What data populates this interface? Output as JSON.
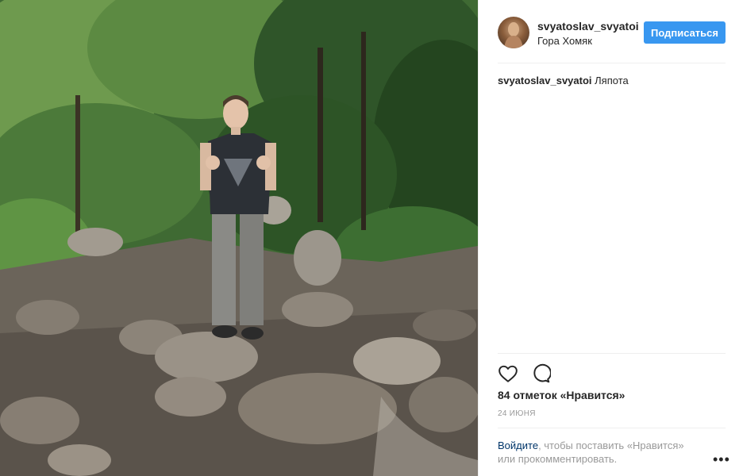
{
  "post": {
    "username": "svyatoslav_svyatoi",
    "location": "Гора Хомяк",
    "follow_label": "Подписаться",
    "caption_user": "svyatoslav_svyatoi",
    "caption_text": " Ляпота",
    "likes_text": "84 отметок «Нравится»",
    "date": "24 ИЮНЯ",
    "login_link": "Войдите",
    "login_rest": ", чтобы поставить «Нравится» или прокомментировать.",
    "more_label": "•••"
  },
  "colors": {
    "follow_button": "#3897f0",
    "link": "#003569",
    "muted": "#999999"
  },
  "icons": {
    "like": "heart-outline",
    "comment": "speech-bubble-outline",
    "more": "three-dots"
  }
}
